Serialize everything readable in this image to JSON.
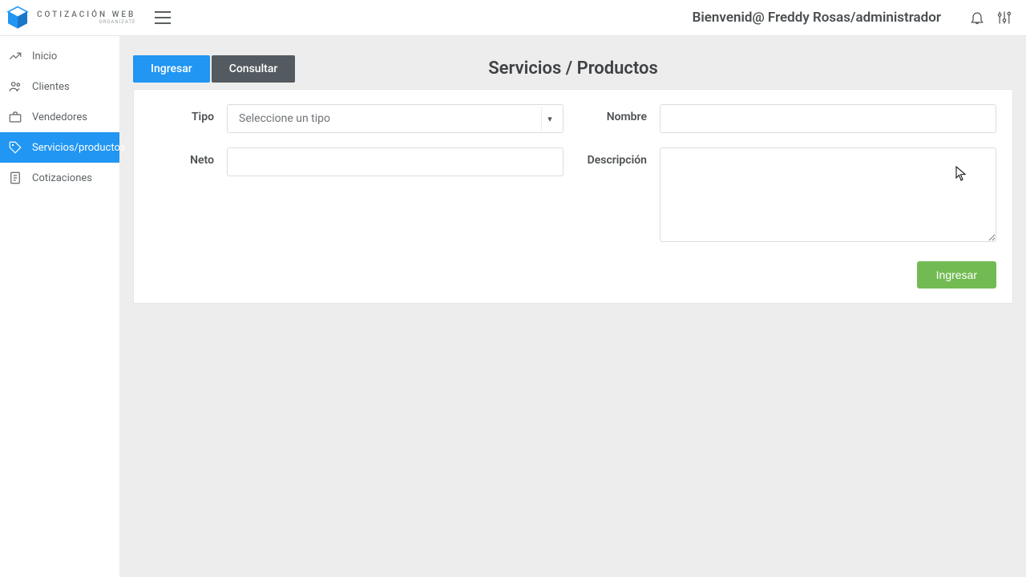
{
  "brand": {
    "name": "COTIZACIÓN WEB",
    "tagline": "ORGANIZATE"
  },
  "topbar": {
    "welcome": "Bienvenid@ Freddy Rosas/administrador"
  },
  "sidebar": {
    "items": [
      {
        "label": "Inicio"
      },
      {
        "label": "Clientes"
      },
      {
        "label": "Vendedores"
      },
      {
        "label": "Servicios/productos"
      },
      {
        "label": "Cotizaciones"
      }
    ]
  },
  "page": {
    "title": "Servicios / Productos"
  },
  "tabs": {
    "ingresar": "Ingresar",
    "consultar": "Consultar"
  },
  "form": {
    "tipo_label": "Tipo",
    "tipo_placeholder": "Seleccione un tipo",
    "neto_label": "Neto",
    "nombre_label": "Nombre",
    "descripcion_label": "Descripción",
    "submit_label": "Ingresar"
  },
  "colors": {
    "primary": "#2196f3",
    "success": "#72bb53",
    "tab_secondary": "#545b60"
  }
}
